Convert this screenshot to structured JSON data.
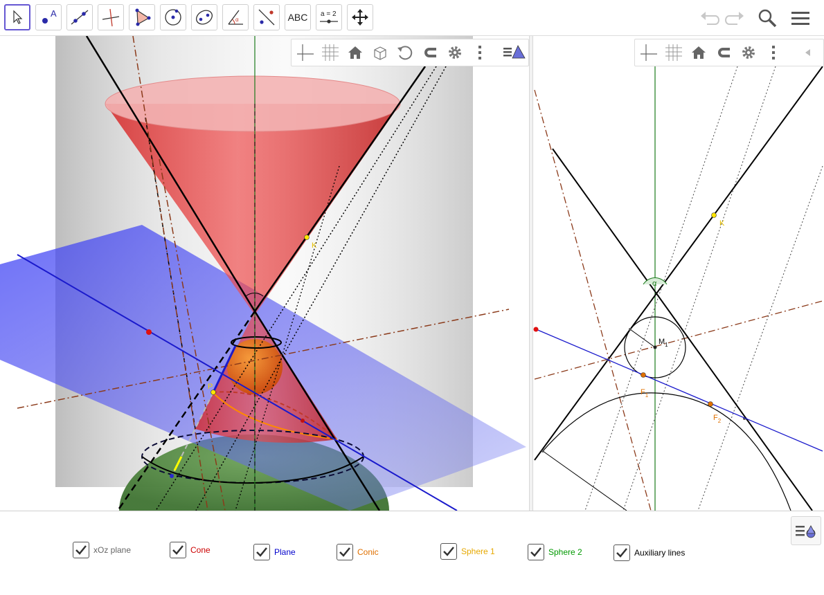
{
  "toolbar": {
    "tools": [
      {
        "id": "move",
        "icon": "arrow-cursor-icon",
        "label": ""
      },
      {
        "id": "point",
        "icon": "point-icon",
        "label": "A"
      },
      {
        "id": "line",
        "icon": "line-through-points-icon",
        "label": ""
      },
      {
        "id": "perpendicular",
        "icon": "perpendicular-line-icon",
        "label": ""
      },
      {
        "id": "polygon",
        "icon": "polygon-icon",
        "label": ""
      },
      {
        "id": "circle",
        "icon": "circle-center-point-icon",
        "label": ""
      },
      {
        "id": "ellipse",
        "icon": "ellipse-icon",
        "label": ""
      },
      {
        "id": "angle",
        "icon": "angle-icon",
        "label": "α"
      },
      {
        "id": "reflect",
        "icon": "reflect-line-icon",
        "label": ""
      },
      {
        "id": "text",
        "icon": "text-icon",
        "label": "ABC"
      },
      {
        "id": "slider",
        "icon": "slider-icon",
        "label": "a = 2"
      },
      {
        "id": "move-view",
        "icon": "move-graphics-view-icon",
        "label": ""
      }
    ],
    "right_icons": [
      "undo-icon",
      "redo-icon",
      "search-icon",
      "menu-icon"
    ]
  },
  "view3d": {
    "stylebar_icons": [
      "axes-icon",
      "grid-icon",
      "home-icon",
      "cube-icon",
      "rotate-icon",
      "magnet-icon",
      "gear-icon",
      "more-vertical-icon",
      "algebra-view-icon"
    ],
    "labels": {
      "point_k": "K",
      "point_p": "P"
    }
  },
  "view2d": {
    "stylebar_icons": [
      "axes-icon",
      "grid-icon",
      "home-icon",
      "magnet-icon",
      "gear-icon",
      "more-vertical-icon",
      "collapse-left-icon"
    ],
    "labels": {
      "point_k": "K",
      "alpha": "α",
      "center": "M",
      "center_sub": "1",
      "f1": "F",
      "f1_sub": "1",
      "f2": "F",
      "f2_sub": "2"
    }
  },
  "checkboxes": [
    {
      "label": "xOz plane",
      "checked": true,
      "color": "#666666"
    },
    {
      "label": "Cone",
      "checked": true,
      "color": "#cc0000"
    },
    {
      "label": "Plane",
      "checked": true,
      "color": "#0000cc"
    },
    {
      "label": "Conic",
      "checked": true,
      "color": "#e07000"
    },
    {
      "label": "Sphere 1",
      "checked": true,
      "color": "#e6a800"
    },
    {
      "label": "Sphere 2",
      "checked": true,
      "color": "#009900"
    },
    {
      "label": "Auxiliary lines",
      "checked": true,
      "color": "#000000"
    }
  ],
  "colors": {
    "accent": "#6557d2",
    "cone": "#d42020",
    "plane": "#4a4cf0",
    "sphere_orange": "#e0651a",
    "sphere_green": "#4e8a3a",
    "axis_green": "#1a7a1a",
    "aux_brown": "#8b3a1a"
  }
}
